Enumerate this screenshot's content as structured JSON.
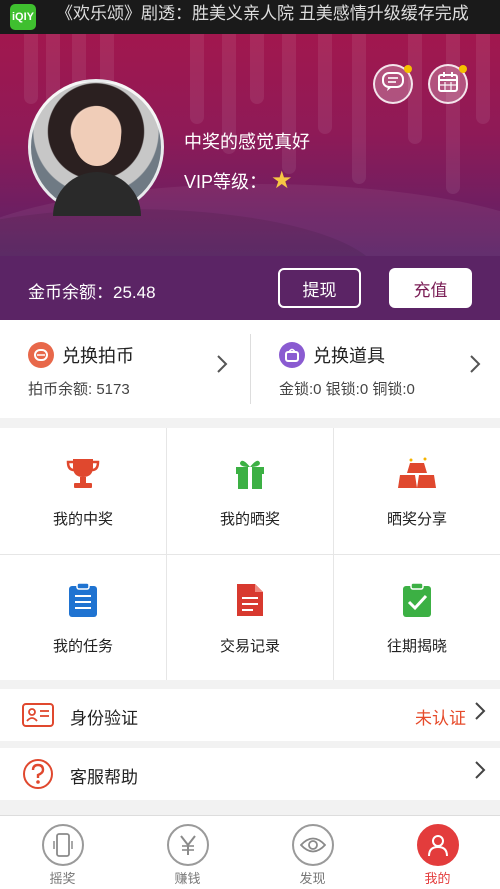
{
  "status_bar": {
    "app_icon_text": "iQIY",
    "ticker": "《欢乐颂》剧透：胜美义亲人院 丑美感情升级缓存完成"
  },
  "profile": {
    "username": "中奖的感觉真好",
    "vip_label": "VIP等级：",
    "vip_icon": "star-icon",
    "vip_star_color": "#f6c744"
  },
  "header_buttons": [
    {
      "name": "message-icon",
      "has_dot": true
    },
    {
      "name": "calendar-icon",
      "has_dot": true
    }
  ],
  "balance": {
    "text": "金币余额：25.48",
    "withdraw_label": "提现",
    "recharge_label": "充值"
  },
  "exchange": {
    "coins": {
      "title": "兑换拍币",
      "sub": "拍币余额: 5173",
      "icon": "coin-icon",
      "color": "#e8684a"
    },
    "props": {
      "title": "兑换道具",
      "sub": "金锁:0 银锁:0 铜锁:0",
      "icon": "basket-icon",
      "color": "#8a5bd1"
    }
  },
  "grid": [
    {
      "label": "我的中奖",
      "icon": "trophy-icon",
      "color": "#e0482e"
    },
    {
      "label": "我的晒奖",
      "icon": "gift-icon",
      "color": "#3cb044"
    },
    {
      "label": "晒奖分享",
      "icon": "gold-bars-icon",
      "color": "#e0482e"
    },
    {
      "label": "我的任务",
      "icon": "clipboard-icon",
      "color": "#1f73d1"
    },
    {
      "label": "交易记录",
      "icon": "document-icon",
      "color": "#d8392f"
    },
    {
      "label": "往期揭晓",
      "icon": "checklist-icon",
      "color": "#3cb044"
    }
  ],
  "rows": {
    "identity": {
      "label": "身份验证",
      "status": "未认证",
      "icon": "id-card-icon",
      "color": "#e0482e"
    },
    "support": {
      "label": "客服帮助",
      "icon": "help-icon",
      "color": "#e0482e"
    }
  },
  "tabs": [
    {
      "label": "摇奖",
      "icon": "phone-shake-icon",
      "active": false
    },
    {
      "label": "赚钱",
      "icon": "yen-icon",
      "active": false
    },
    {
      "label": "发现",
      "icon": "eye-icon",
      "active": false
    },
    {
      "label": "我的",
      "icon": "user-icon",
      "active": true
    }
  ],
  "colors": {
    "accent": "#e33c3c",
    "header_top": "#a2174e",
    "header_bottom": "#5b2465",
    "status_warning": "#e64b2b"
  }
}
